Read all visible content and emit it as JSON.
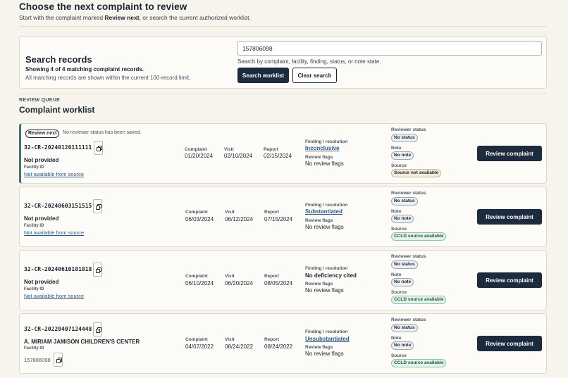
{
  "header": {
    "title": "Choose the next complaint to review",
    "subtitle_pre": "Start with the complaint marked ",
    "subtitle_bold": "Review next",
    "subtitle_post": ", or search the current authorized worklist."
  },
  "search": {
    "title": "Search records",
    "count_text": "Showing 4 of 4 matching complaint records.",
    "limit_text": "All matching records are shown within the current 100-record limit.",
    "query": "157806098",
    "help_text": "Search by complaint, facility, finding, status, or note state.",
    "search_button": "Search worklist",
    "clear_button": "Clear search"
  },
  "queue": {
    "kicker": "REVIEW QUEUE",
    "title": "Complaint worklist"
  },
  "labels": {
    "complaint": "Complaint",
    "visit": "Visit",
    "report": "Report",
    "finding": "Finding / resolution",
    "flags": "Review flags",
    "reviewer_status": "Reviewer status",
    "note": "Note",
    "source": "Source",
    "facility_id": "Facility ID",
    "review_button": "Review complaint"
  },
  "records": [
    {
      "review_next": "Review next",
      "review_note": "No reviewer status has been saved.",
      "complaint_id": "32-CR-20240120111111",
      "facility_name": "Not provided",
      "facility_id": "Not available from source",
      "complaint_date": "01/20/2024",
      "visit_date": "02/10/2024",
      "report_date": "02/15/2024",
      "finding": "Inconclusive",
      "flags": "No review flags",
      "status": "No status",
      "note": "No note",
      "source": "Source not available"
    },
    {
      "complaint_id": "32-CR-20240603151515",
      "facility_name": "Not provided",
      "facility_id": "Not available from source",
      "complaint_date": "06/03/2024",
      "visit_date": "06/12/2024",
      "report_date": "07/15/2024",
      "finding": "Substantiated",
      "flags": "No review flags",
      "status": "No status",
      "note": "No note",
      "source": "CCLD source available"
    },
    {
      "complaint_id": "32-CR-20240610181818",
      "facility_name": "Not provided",
      "facility_id": "Not available from source",
      "complaint_date": "06/10/2024",
      "visit_date": "06/20/2024",
      "report_date": "08/05/2024",
      "finding": "No deficiency cited",
      "flags": "No review flags",
      "status": "No status",
      "note": "No note",
      "source": "CCLD source available"
    },
    {
      "complaint_id": "32-CR-20220407124448",
      "facility_name": "A. MIRIAM JAMISON CHILDREN'S CENTER",
      "facility_id": "157806098",
      "complaint_date": "04/07/2022",
      "visit_date": "08/24/2022",
      "report_date": "08/24/2022",
      "finding": "Unsubstantiated",
      "flags": "No review flags",
      "status": "No status",
      "note": "No note",
      "source": "CCLD source available"
    }
  ]
}
